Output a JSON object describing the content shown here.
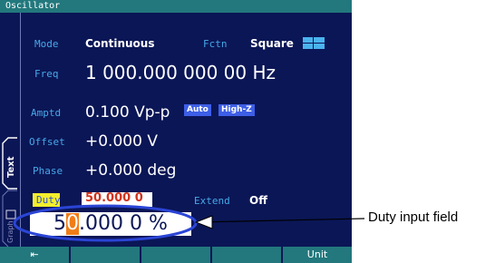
{
  "window": {
    "title": "Oscillator"
  },
  "params": {
    "mode": {
      "label": "Mode",
      "value": "Continuous"
    },
    "fctn": {
      "label": "Fctn",
      "value": "Square",
      "icon": "square-wave-icon"
    },
    "freq": {
      "label": "Freq",
      "value": "1 000.000 000 00 Hz"
    },
    "amptd": {
      "label": "Amptd",
      "value": "0.100 Vp-p",
      "badges": [
        "Auto",
        "High-Z"
      ]
    },
    "offset": {
      "label": "Offset",
      "value": "+0.000 V"
    },
    "phase": {
      "label": "Phase",
      "value": "+0.000 deg"
    },
    "duty": {
      "label": "Duty",
      "value": "50.000 0 %"
    },
    "extend": {
      "label": "Extend",
      "value": "Off"
    }
  },
  "side_tabs": {
    "text": "Text",
    "graph": "Graph"
  },
  "duty_input": {
    "before_cursor": "5",
    "cursor_char": "0",
    "after_cursor": ".000 0 %"
  },
  "softkeys": [
    {
      "label": "⇤",
      "icon": "back-arrow-icon"
    },
    {
      "label": ""
    },
    {
      "label": ""
    },
    {
      "label": ""
    },
    {
      "label": "Unit"
    }
  ],
  "annotation": {
    "text": "Duty input field"
  },
  "colors": {
    "screen_bg": "#0b1656",
    "title_bar": "#22787d",
    "label": "#47a8e8",
    "highlight": "#f3ef2c",
    "cursor": "#f07d17",
    "badge": "#3d5ee6",
    "callout_line": "#2b45d6"
  }
}
